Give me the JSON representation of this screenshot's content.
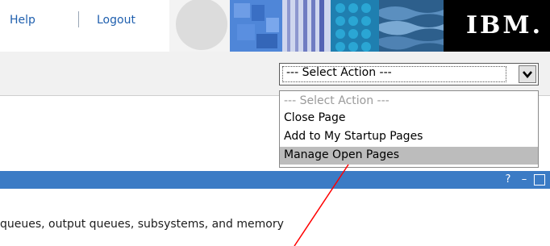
{
  "header": {
    "help_label": "Help",
    "logout_label": "Logout",
    "logo_text": "IBM."
  },
  "action_select": {
    "current_value": "--- Select Action ---",
    "options": [
      {
        "label": "--- Select Action ---",
        "state": "disabled"
      },
      {
        "label": "Close Page",
        "state": "normal"
      },
      {
        "label": "Add to My Startup Pages",
        "state": "normal"
      },
      {
        "label": "Manage Open Pages",
        "state": "highlighted"
      }
    ]
  },
  "portlet": {
    "help_glyph": "?",
    "minimize_glyph": "–",
    "maximize_icon": "maximize-icon"
  },
  "content": {
    "description": "queues, output queues, subsystems, and memory"
  },
  "colors": {
    "link": "#1f5fae",
    "portlet_bar": "#3b7bc5",
    "annotation_line": "#ff0000"
  }
}
